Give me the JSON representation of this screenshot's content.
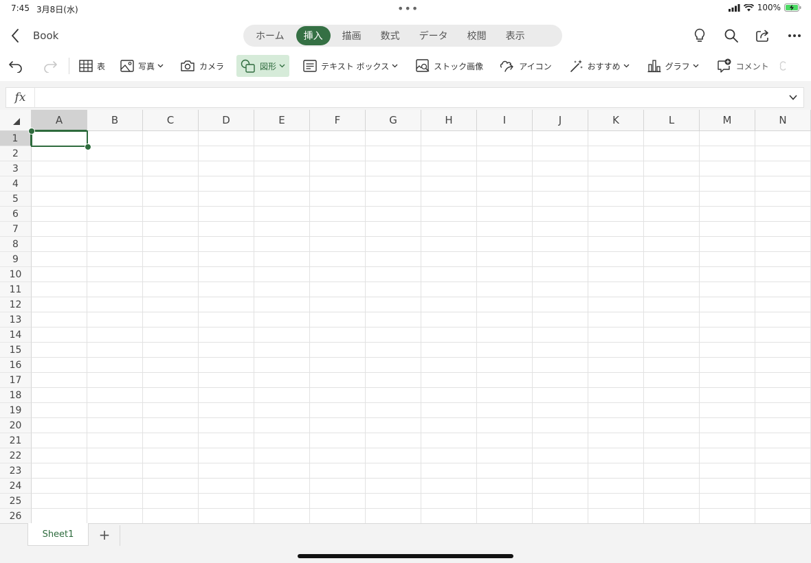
{
  "status": {
    "time": "7:45",
    "date": "3月8日(水)",
    "dots": "•••",
    "battery_pct": "100%"
  },
  "header": {
    "title": "Book",
    "tabs": [
      {
        "label": "ホーム",
        "active": false
      },
      {
        "label": "挿入",
        "active": true
      },
      {
        "label": "描画",
        "active": false
      },
      {
        "label": "数式",
        "active": false
      },
      {
        "label": "データ",
        "active": false
      },
      {
        "label": "校閲",
        "active": false
      },
      {
        "label": "表示",
        "active": false
      }
    ],
    "icons": [
      "lightbulb-icon",
      "search-icon",
      "share-icon",
      "more-icon"
    ]
  },
  "toolbar": {
    "table": "表",
    "photo": "写真",
    "camera": "カメラ",
    "shapes": "図形",
    "textbox": "テキスト ボックス",
    "stock": "ストック画像",
    "icons": "アイコン",
    "recommend": "おすすめ",
    "chart": "グラフ",
    "comment": "コメント"
  },
  "formula": {
    "label": "fx",
    "value": ""
  },
  "grid": {
    "columns": [
      "A",
      "B",
      "C",
      "D",
      "E",
      "F",
      "G",
      "H",
      "I",
      "J",
      "K",
      "L",
      "M",
      "N"
    ],
    "rows": [
      "1",
      "2",
      "3",
      "4",
      "5",
      "6",
      "7",
      "8",
      "9",
      "10",
      "11",
      "12",
      "13",
      "14",
      "15",
      "16",
      "17",
      "18",
      "19",
      "20",
      "21",
      "22",
      "23",
      "24",
      "25",
      "26"
    ],
    "selected_column": "A",
    "selected_row": "1"
  },
  "sheets": {
    "tabs": [
      "Sheet1"
    ],
    "add": "+"
  },
  "colors": {
    "accent": "#357044",
    "selected_tool_bg": "#d6ebd9"
  }
}
